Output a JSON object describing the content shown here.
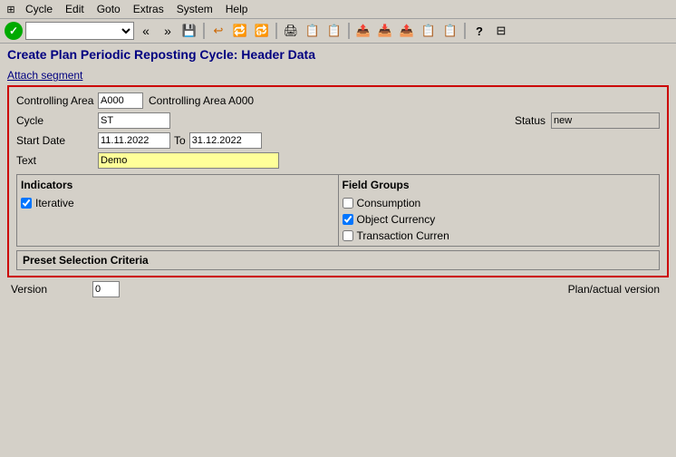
{
  "menubar": {
    "icon_label": "⊞",
    "items": [
      "Cycle",
      "Edit",
      "Goto",
      "Extras",
      "System",
      "Help"
    ]
  },
  "toolbar": {
    "green_check": "✓",
    "nav_back": "«",
    "nav_fwd": "»",
    "save_icon": "💾",
    "icons": [
      "↩",
      "🔄",
      "🔄",
      "🖨",
      "📋",
      "📋",
      "📤",
      "📥",
      "📤",
      "📋",
      "📋",
      "?",
      "⊟"
    ]
  },
  "page": {
    "title": "Create Plan Periodic Reposting Cycle: Header Data",
    "attach_segment_label": "Attach segment"
  },
  "form": {
    "controlling_area_label": "Controlling Area",
    "controlling_area_value": "A000",
    "controlling_area_text": "Controlling Area A000",
    "cycle_label": "Cycle",
    "cycle_value": "ST",
    "status_label": "Status",
    "status_value": "new",
    "start_date_label": "Start Date",
    "start_date_value": "11.11.2022",
    "to_label": "To",
    "end_date_value": "31.12.2022",
    "text_label": "Text",
    "text_value": "Demo",
    "indicators_header": "Indicators",
    "field_groups_header": "Field Groups",
    "iterative_label": "Iterative",
    "iterative_checked": true,
    "consumption_label": "Consumption",
    "consumption_checked": false,
    "object_currency_label": "Object Currency",
    "object_currency_checked": true,
    "transaction_curren_label": "Transaction Curren",
    "transaction_curren_checked": false,
    "preset_label": "Preset Selection Criteria",
    "version_label": "Version",
    "version_value": "0",
    "plan_actual_label": "Plan/actual version"
  }
}
